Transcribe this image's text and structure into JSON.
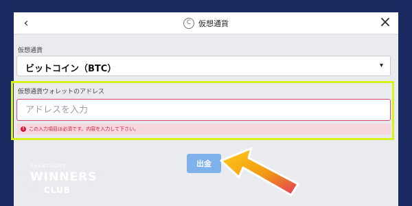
{
  "header": {
    "back_icon": "chevron-left-icon",
    "coin_icon": "coin-icon",
    "coin_symbol": "C",
    "title": "仮想通貨",
    "close_icon": "close-icon"
  },
  "form": {
    "currency_label": "仮想通貨",
    "currency_value": "ビットコイン（BTC）",
    "currency_caret": "▾",
    "wallet_label": "仮想通貨ウォレットのアドレス",
    "wallet_placeholder": "アドレスを入力",
    "wallet_value": "",
    "error_icon": "!",
    "error_message": "この入力項目は必須です。内容を入力して下さい。",
    "submit_label": "出金"
  },
  "logo": {
    "small": "PHANTASMS",
    "big": "WINNERS",
    "club": "CLUB"
  },
  "colors": {
    "accent_blue": "#7fb2ea",
    "highlight_yellow": "#d9f21d",
    "error_red": "#d4183d",
    "arrow_orange": "#f39a14",
    "arrow_pink": "#e23a5a"
  }
}
